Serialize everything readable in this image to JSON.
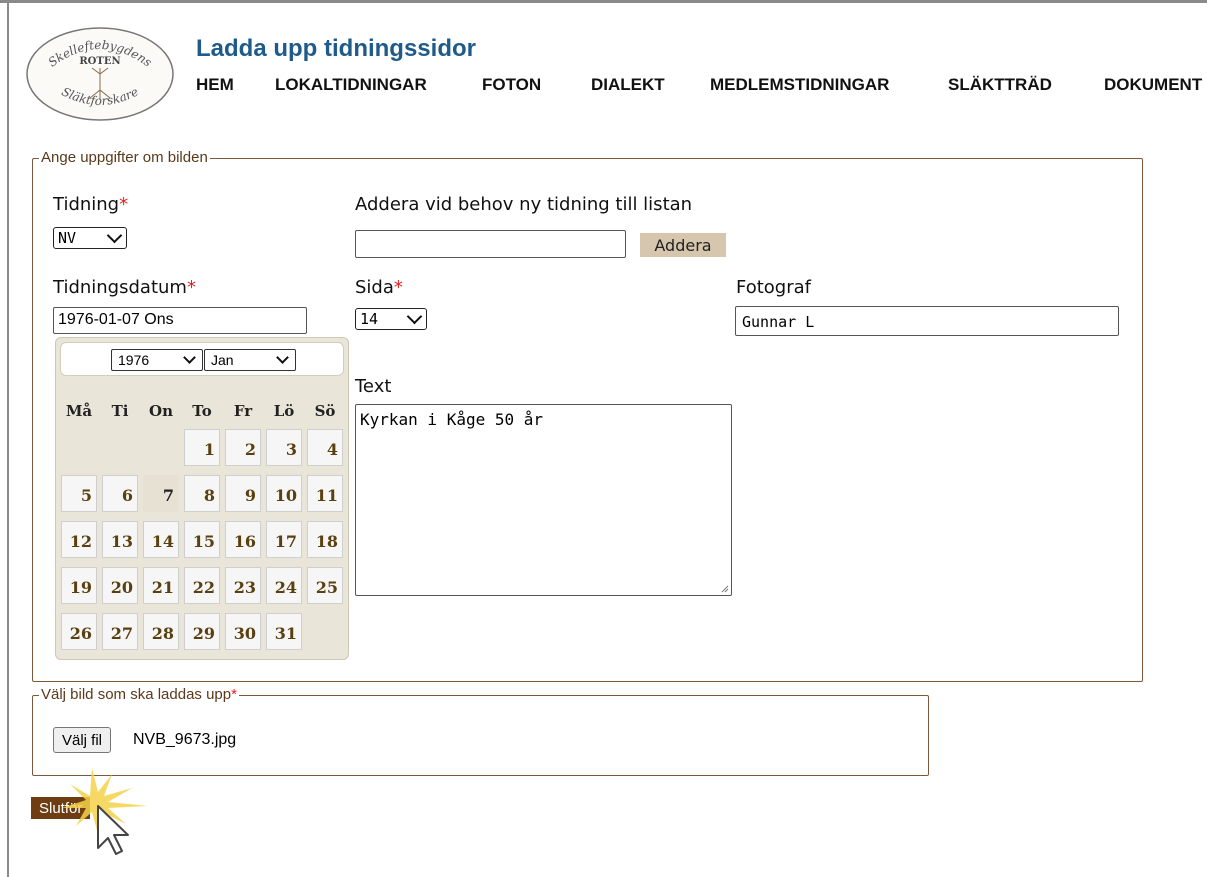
{
  "header": {
    "title": "Ladda upp tidningssidor",
    "logo": {
      "line1": "Skelleftebygdens",
      "line2": "ROTEN",
      "line3": "Släktforskare"
    },
    "nav": [
      "HEM",
      "LOKALTIDNINGAR",
      "FOTON",
      "DIALEKT",
      "MEDLEMSTIDNINGAR",
      "SLÄKTTRÄD",
      "DOKUMENT"
    ]
  },
  "details": {
    "legend": "Ange uppgifter om bilden",
    "newspaper_label": "Tidning",
    "newspaper_value": "NV",
    "add_label": "Addera vid behov ny tidning till listan",
    "add_input_value": "",
    "add_button": "Addera",
    "date_label": "Tidningsdatum",
    "date_value": "1976-01-07 Ons",
    "page_label": "Sida",
    "page_value": "14",
    "photographer_label": "Fotograf",
    "photographer_value": "Gunnar L",
    "text_label": "Text",
    "text_value": "Kyrkan i Kåge 50 år",
    "required_mark": "*"
  },
  "calendar": {
    "year": "1976",
    "month": "Jan",
    "weekdays": [
      "Må",
      "Ti",
      "On",
      "To",
      "Fr",
      "Lö",
      "Sö"
    ],
    "first_weekday_index": 3,
    "days_in_month": 31,
    "selected_day": 7
  },
  "upload": {
    "legend": "Välj bild som ska laddas upp",
    "choose_button": "Välj fil",
    "filename": "NVB_9673.jpg"
  },
  "submit_button": "Slutför"
}
